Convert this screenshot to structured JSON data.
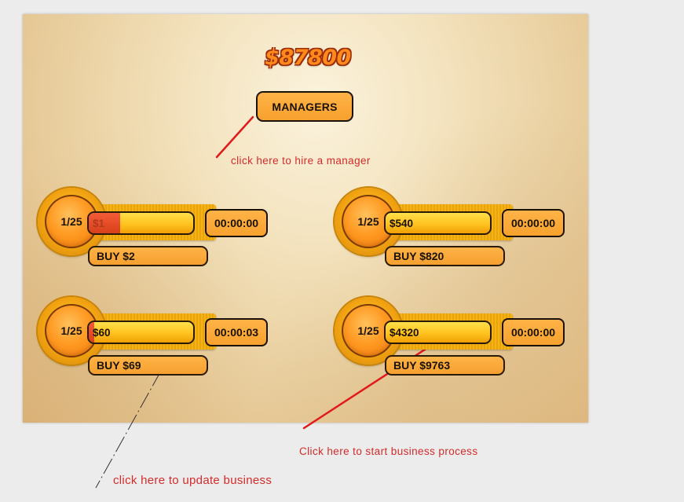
{
  "header": {
    "money": "$87800",
    "managers_label": "MANAGERS"
  },
  "businesses": [
    {
      "level": "1/25",
      "income": "$1",
      "progress": 0.3,
      "timer": "00:00:00",
      "buy": "BUY $2"
    },
    {
      "level": "1/25",
      "income": "$540",
      "progress": 0,
      "timer": "00:00:00",
      "buy": "BUY $820"
    },
    {
      "level": "1/25",
      "income": "$60",
      "progress": 0.05,
      "timer": "00:00:03",
      "buy": "BUY $69"
    },
    {
      "level": "1/25",
      "income": "$4320",
      "progress": 0,
      "timer": "00:00:00",
      "buy": "BUY $9763"
    }
  ],
  "annotations": {
    "hire_manager": "click here to hire a manager",
    "start_process": "Click here to start business process",
    "update_business": "click here to update business"
  },
  "colors": {
    "annotation_red": "#d32b2b",
    "money_orange": "#ff8a1c",
    "button_orange": "#f7a12e",
    "progress_red": "#d9401c"
  }
}
